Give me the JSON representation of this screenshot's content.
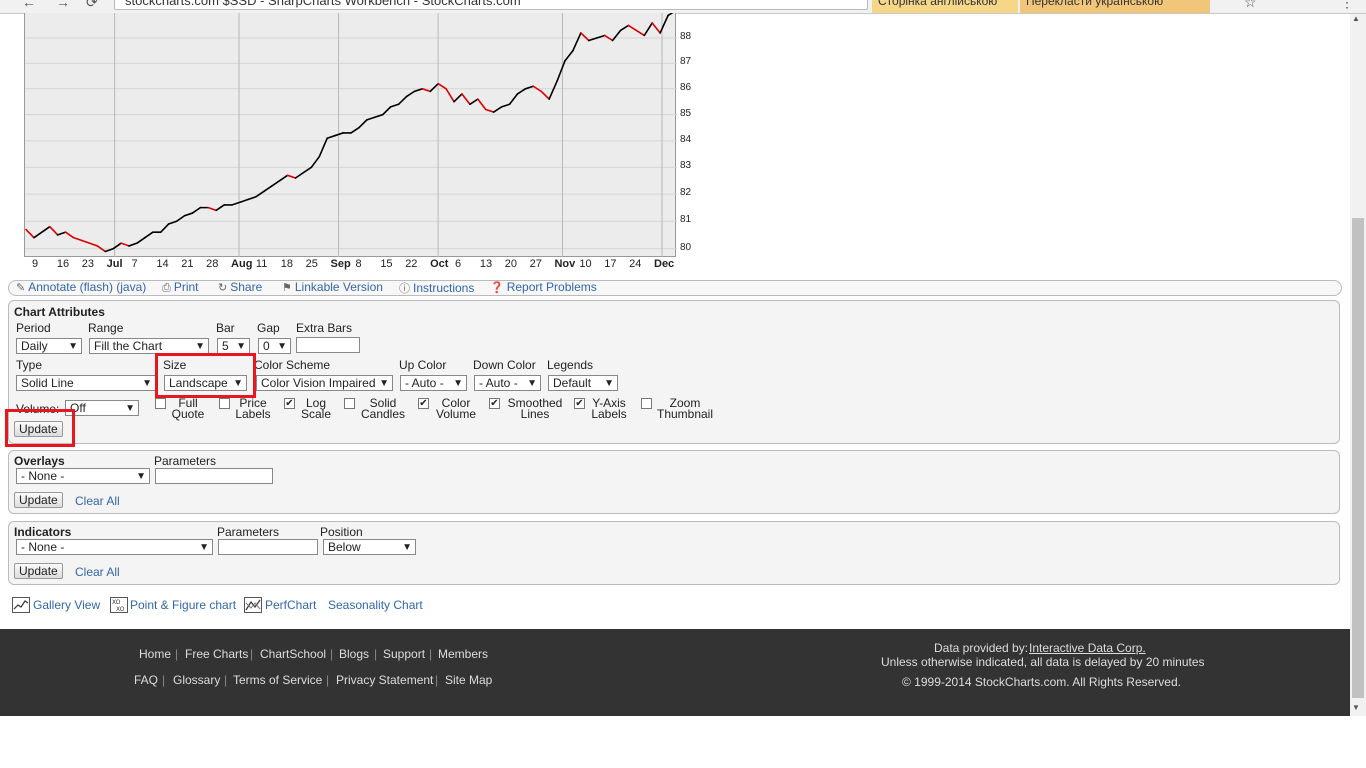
{
  "browser": {
    "url_text": "stockcharts.com   $SSD - SharpCharts Workbench - StockCharts.com",
    "ext1": "Сторінка англійською",
    "ext2": "Перекласти українською",
    "back_glyph": "←",
    "forward_glyph": "→",
    "refresh_glyph": "⟳",
    "star_glyph": "☆",
    "close_glyph": "✕",
    "menu_glyph": "⋮"
  },
  "chart_data": {
    "type": "line",
    "series": [
      {
        "values": [
          80.7,
          80.4,
          80.6,
          80.8,
          80.5,
          80.6,
          80.4,
          80.3,
          80.2,
          80.1,
          79.9,
          80.0,
          80.2,
          80.1,
          80.2,
          80.4,
          80.6,
          80.6,
          80.9,
          81.0,
          81.2,
          81.3,
          81.5,
          81.5,
          81.4,
          81.6,
          81.6,
          81.7,
          81.8,
          81.9,
          82.1,
          82.3,
          82.5,
          82.7,
          82.6,
          82.8,
          83.0,
          83.4,
          84.1,
          84.2,
          84.3,
          84.3,
          84.5,
          84.8,
          84.9,
          85.0,
          85.3,
          85.4,
          85.7,
          85.9,
          86.0,
          85.9,
          86.2,
          86.0,
          85.5,
          85.8,
          85.4,
          85.6,
          85.2,
          85.1,
          85.3,
          85.4,
          85.8,
          86.0,
          86.1,
          85.9,
          85.6,
          86.3,
          87.1,
          87.5,
          88.2,
          87.9,
          88.0,
          88.1,
          87.9,
          88.3,
          88.5,
          88.3,
          88.1,
          88.6,
          88.2,
          88.9,
          89.1
        ],
        "color": "#000000",
        "down_color": "#dd0000"
      }
    ],
    "ylim": [
      79.7,
      89.0
    ],
    "yticks": [
      80,
      81,
      82,
      83,
      84,
      85,
      86,
      87,
      88
    ],
    "xticks": [
      {
        "label": "9",
        "bold": false
      },
      {
        "label": "16",
        "bold": false
      },
      {
        "label": "23",
        "bold": false
      },
      {
        "label": "Jul",
        "bold": true
      },
      {
        "label": "7",
        "bold": false
      },
      {
        "label": "14",
        "bold": false
      },
      {
        "label": "21",
        "bold": false
      },
      {
        "label": "28",
        "bold": false
      },
      {
        "label": "Aug",
        "bold": true
      },
      {
        "label": "11",
        "bold": false
      },
      {
        "label": "18",
        "bold": false
      },
      {
        "label": "25",
        "bold": false
      },
      {
        "label": "Sep",
        "bold": true
      },
      {
        "label": "8",
        "bold": false
      },
      {
        "label": "15",
        "bold": false
      },
      {
        "label": "22",
        "bold": false
      },
      {
        "label": "Oct",
        "bold": true
      },
      {
        "label": "6",
        "bold": false
      },
      {
        "label": "13",
        "bold": false
      },
      {
        "label": "20",
        "bold": false
      },
      {
        "label": "27",
        "bold": false
      },
      {
        "label": "Nov",
        "bold": true
      },
      {
        "label": "10",
        "bold": false
      },
      {
        "label": "17",
        "bold": false
      },
      {
        "label": "24",
        "bold": false
      },
      {
        "label": "Dec",
        "bold": true
      }
    ],
    "grid": true,
    "y_scale": "log"
  },
  "toolbar": {
    "annotate": "Annotate (flash) (java)",
    "print": "Print",
    "share": "Share",
    "linkable": "Linkable Version",
    "instructions": "Instructions",
    "report": "Report Problems"
  },
  "attributes": {
    "title": "Chart Attributes",
    "period_label": "Period",
    "period_value": "Daily",
    "range_label": "Range",
    "range_value": "Fill the Chart",
    "bar_label": "Bar",
    "bar_value": "5",
    "gap_label": "Gap",
    "gap_value": "0",
    "extra_bars_label": "Extra Bars",
    "type_label": "Type",
    "type_value": "Solid Line",
    "size_label": "Size",
    "size_value": "Landscape",
    "color_scheme_label": "Color Scheme",
    "color_scheme_value": "Color Vision Impaired",
    "up_color_label": "Up Color",
    "up_color_value": "- Auto -",
    "down_color_label": "Down Color",
    "down_color_value": "- Auto -",
    "legends_label": "Legends",
    "legends_value": "Default",
    "volume_label": "Volume:",
    "volume_value": "Off",
    "checkboxes": [
      {
        "line1": "Full",
        "line2": "Quote",
        "checked": false
      },
      {
        "line1": "Price",
        "line2": "Labels",
        "checked": false
      },
      {
        "line1": "Log",
        "line2": "Scale",
        "checked": true
      },
      {
        "line1": "Solid",
        "line2": "Candles",
        "checked": false
      },
      {
        "line1": "Color",
        "line2": "Volume",
        "checked": true
      },
      {
        "line1": "Smoothed",
        "line2": "Lines",
        "checked": true
      },
      {
        "line1": "Y-Axis",
        "line2": "Labels",
        "checked": true
      },
      {
        "line1": "Zoom",
        "line2": "Thumbnail",
        "checked": false
      }
    ],
    "update": "Update"
  },
  "overlays": {
    "title": "Overlays",
    "parameters_label": "Parameters",
    "value": "- None -",
    "update": "Update",
    "clear_all": "Clear All"
  },
  "indicators": {
    "title": "Indicators",
    "parameters_label": "Parameters",
    "position_label": "Position",
    "value": "- None -",
    "position_value": "Below",
    "update": "Update",
    "clear_all": "Clear All"
  },
  "views": {
    "gallery": "Gallery View",
    "pnf": "Point & Figure chart",
    "perf": "PerfChart",
    "seasonality": "Seasonality Chart"
  },
  "footer": {
    "row1": [
      "Home",
      "Free Charts",
      "ChartSchool",
      "Blogs",
      "Support",
      "Members"
    ],
    "row2": [
      "FAQ",
      "Glossary",
      "Terms of Service",
      "Privacy Statement",
      "Site Map"
    ],
    "data_provided_by": "Data provided by:",
    "provider": "Interactive Data Corp.",
    "delay_note": "Unless otherwise indicated, all data is delayed by 20 minutes",
    "copyright": "© 1999-2014 StockCharts.com. All Rights Reserved."
  }
}
